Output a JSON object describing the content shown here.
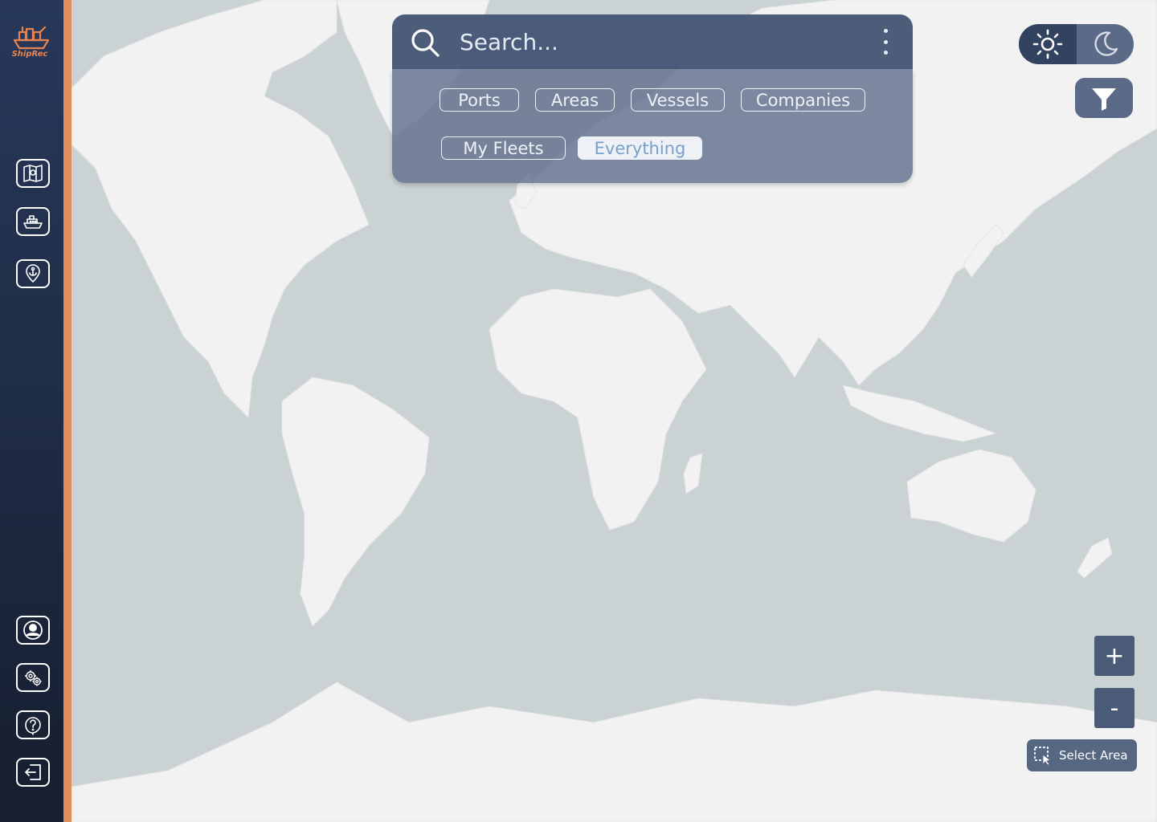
{
  "app": {
    "brand": "ShipRec"
  },
  "sidebar": {
    "top_items": [
      {
        "icon": "map-icon"
      },
      {
        "icon": "ship-icon"
      },
      {
        "icon": "port-anchor-icon"
      }
    ],
    "bottom_items": [
      {
        "icon": "user-profile-icon"
      },
      {
        "icon": "settings-icon"
      },
      {
        "icon": "help-icon"
      },
      {
        "icon": "logout-icon"
      }
    ]
  },
  "search": {
    "placeholder": "Search...",
    "filters": [
      "Ports",
      "Areas",
      "Vessels",
      "Companies",
      "My Fleets",
      "Everything"
    ],
    "active_filter": "Everything"
  },
  "theme": {
    "current": "light"
  },
  "zoom": {
    "in_label": "+",
    "out_label": "-"
  },
  "select_area": {
    "label": "Select Area"
  },
  "colors": {
    "sidebar": "#27385a",
    "accent": "#e08c5b",
    "ocean": "#cad2d3",
    "land": "#f2f2f2",
    "panel": "#3e5070",
    "active_chip_text": "#7aa0c9"
  }
}
